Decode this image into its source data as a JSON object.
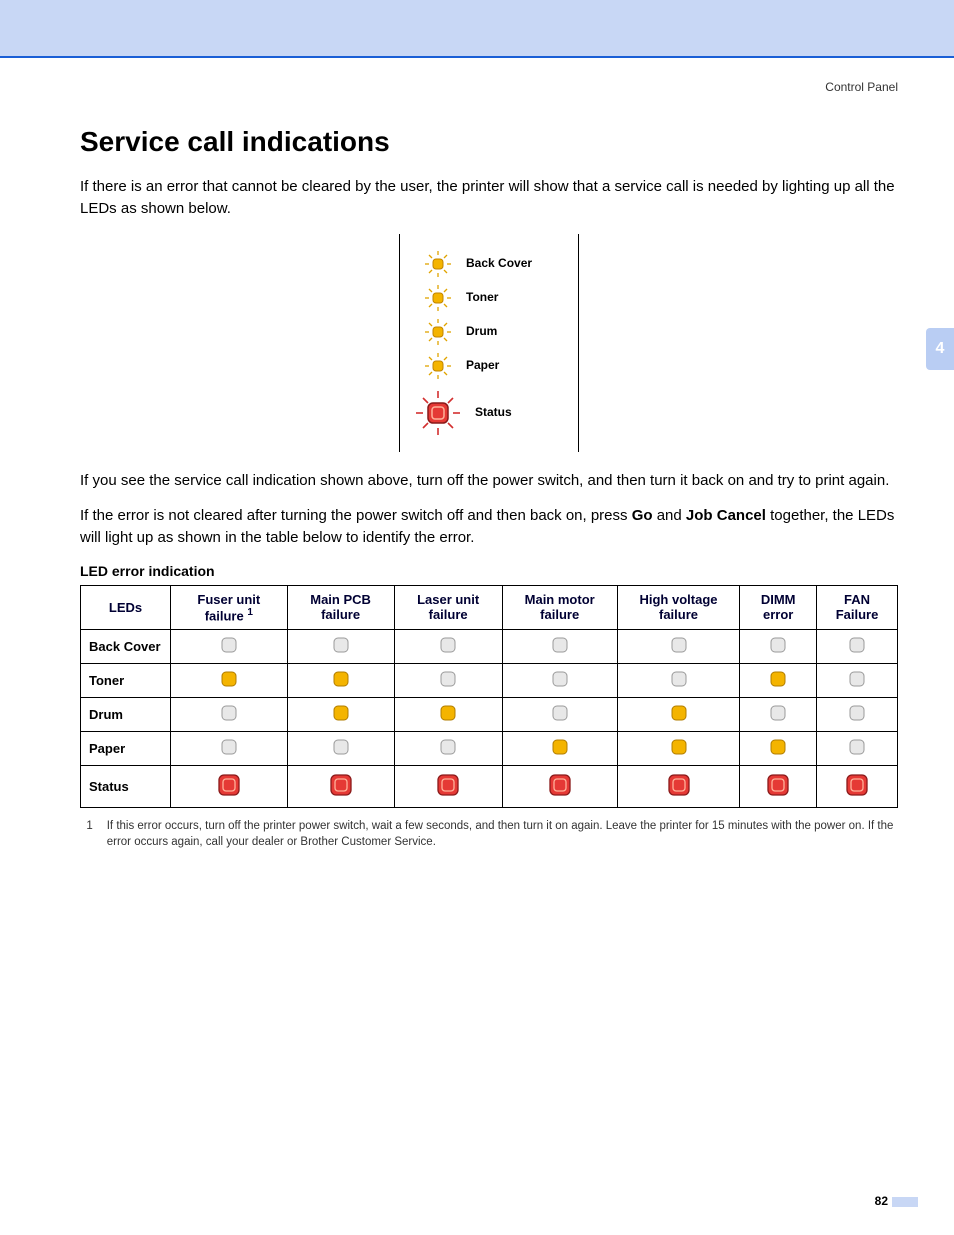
{
  "breadcrumb": "Control Panel",
  "chapter_tab": "4",
  "title": "Service call indications",
  "intro": "If there is an error that cannot be cleared by the user, the printer will show that a service call is needed by lighting up all the LEDs as shown below.",
  "panel_leds": {
    "back_cover": "Back Cover",
    "toner": "Toner",
    "drum": "Drum",
    "paper": "Paper",
    "status": "Status"
  },
  "para2": "If you see the service call indication shown above, turn off the power switch, and then turn it back on and try to print again.",
  "para3_a": "If the error is not cleared after turning the power switch off and then back on, press ",
  "para3_go": "Go",
  "para3_b": " and ",
  "para3_jc": "Job Cancel",
  "para3_c": " together, the LEDs will light up as shown in the table below to identify the error.",
  "table_caption": "LED error indication",
  "columns": {
    "leds": "LEDs",
    "fuser": "Fuser unit failure",
    "fuser_sup": "1",
    "mainpcb": "Main PCB failure",
    "laser": "Laser unit failure",
    "motor": "Main motor failure",
    "hv": "High voltage failure",
    "dimm": "DIMM error",
    "fan": "FAN Failure"
  },
  "rows": {
    "back_cover": "Back Cover",
    "toner": "Toner",
    "drum": "Drum",
    "paper": "Paper",
    "status": "Status"
  },
  "chart_data": {
    "type": "table",
    "title": "LED error indication",
    "legend": {
      "off": "LED off (grey)",
      "on": "LED lit yellow",
      "status_on": "Status LED lit red"
    },
    "columns": [
      "Fuser unit failure",
      "Main PCB failure",
      "Laser unit failure",
      "Main motor failure",
      "High voltage failure",
      "DIMM error",
      "FAN Failure"
    ],
    "rows": [
      "Back Cover",
      "Toner",
      "Drum",
      "Paper",
      "Status"
    ],
    "values": [
      [
        "off",
        "off",
        "off",
        "off",
        "off",
        "off",
        "off"
      ],
      [
        "on",
        "on",
        "off",
        "off",
        "off",
        "on",
        "off"
      ],
      [
        "off",
        "on",
        "on",
        "off",
        "on",
        "off",
        "off"
      ],
      [
        "off",
        "off",
        "off",
        "on",
        "on",
        "on",
        "off"
      ],
      [
        "status_on",
        "status_on",
        "status_on",
        "status_on",
        "status_on",
        "status_on",
        "status_on"
      ]
    ]
  },
  "footnote_num": "1",
  "footnote_text": "If this error occurs, turn off the printer power switch, wait a few seconds, and then turn it on again. Leave the printer for 15 minutes with the power on. If the error occurs again, call your dealer or Brother Customer Service.",
  "page_number": "82"
}
